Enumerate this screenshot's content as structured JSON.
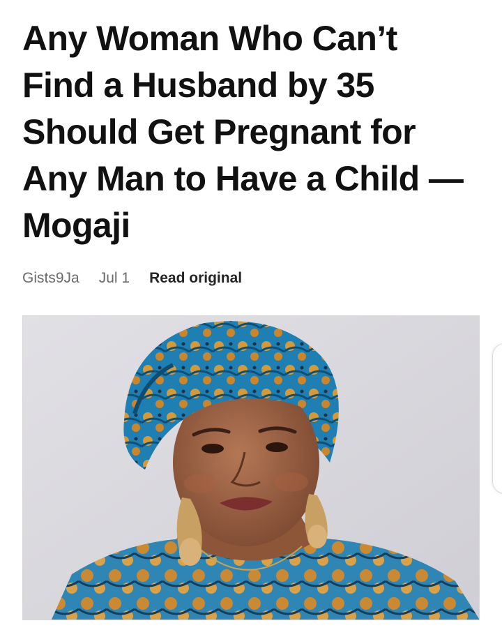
{
  "article": {
    "title_lines": [
      "Any Woman Who Can’t",
      "Find a Husband by 35",
      "Should Get Pregnant for",
      "Any Man to Have a Child —",
      "Mogaji"
    ],
    "author": "Gists9Ja",
    "date": "Jul 1",
    "read_original_label": "Read original"
  },
  "image": {
    "subject": "portrait-woman-headwrap"
  },
  "icons": {
    "edge_panel": "edge-panel-handle-icon"
  }
}
